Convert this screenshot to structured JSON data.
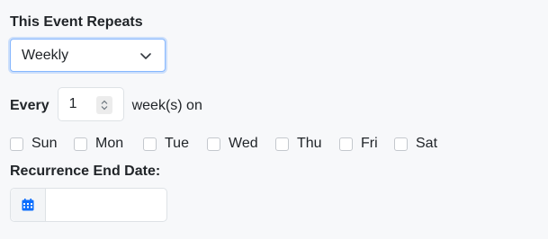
{
  "repeat": {
    "label": "This Event Repeats",
    "selected": "Weekly"
  },
  "interval": {
    "label": "Every",
    "value": "1",
    "suffix": "week(s) on"
  },
  "days": [
    {
      "label": "Sun",
      "checked": false
    },
    {
      "label": "Mon",
      "checked": false
    },
    {
      "label": "Tue",
      "checked": false
    },
    {
      "label": "Wed",
      "checked": false
    },
    {
      "label": "Thu",
      "checked": false
    },
    {
      "label": "Fri",
      "checked": false
    },
    {
      "label": "Sat",
      "checked": false
    }
  ],
  "end_date": {
    "label": "Recurrence End Date:",
    "value": ""
  },
  "icons": {
    "select_arrow": "chevron-down-icon",
    "spinner": "spinner-arrows-icon",
    "calendar": "calendar-icon"
  },
  "colors": {
    "accent": "#0d6efd",
    "focus_border": "#86b7fe"
  }
}
